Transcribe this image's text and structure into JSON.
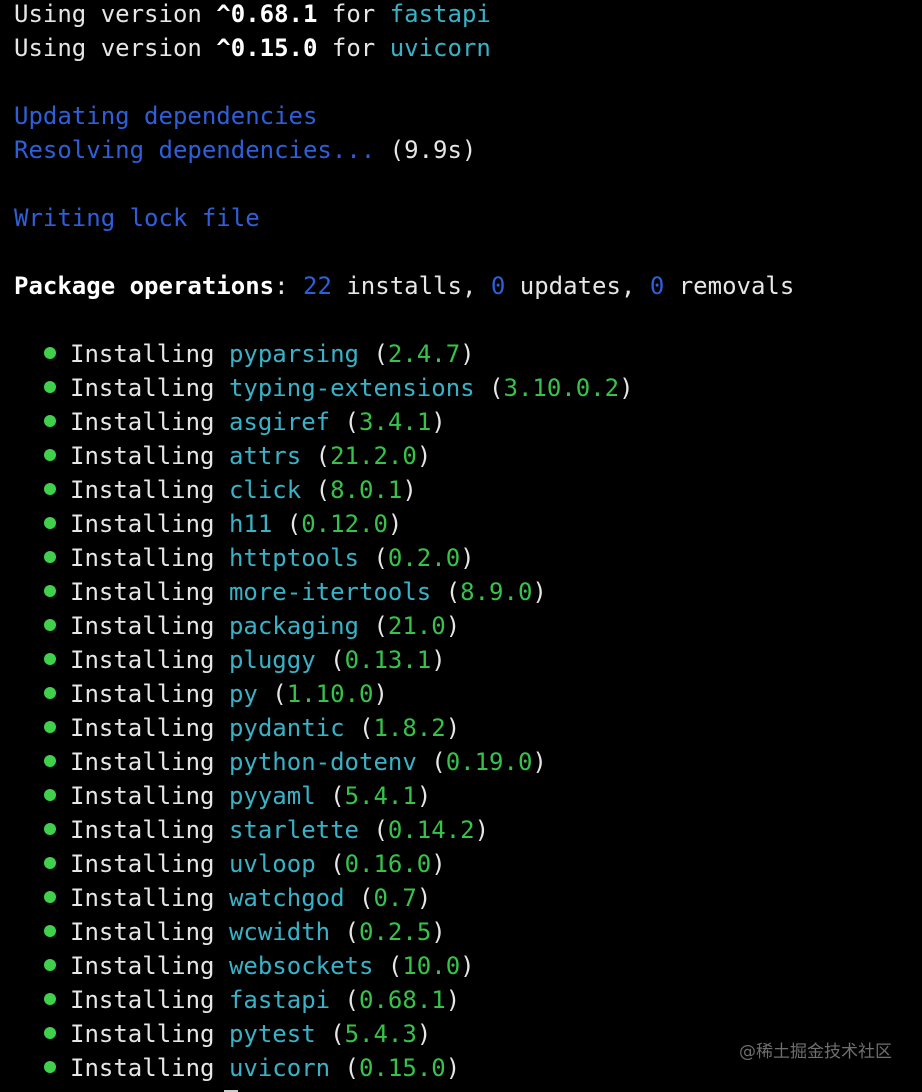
{
  "header_lines": [
    {
      "prefix": "Using version ",
      "version": "^0.68.1",
      "mid": " for ",
      "package": "fastapi"
    },
    {
      "prefix": "Using version ",
      "version": "^0.15.0",
      "mid": " for ",
      "package": "uvicorn"
    }
  ],
  "status": {
    "updating": "Updating dependencies",
    "resolving": "Resolving dependencies...",
    "resolving_time": " (9.9s)",
    "writing": "Writing lock file"
  },
  "operations": {
    "label": "Package operations",
    "sep": ": ",
    "installs_count": "22",
    "installs_label": " installs, ",
    "updates_count": "0",
    "updates_label": " updates, ",
    "removals_count": "0",
    "removals_label": " removals"
  },
  "install_verb": "Installing",
  "packages": [
    {
      "name": "pyparsing",
      "version": "2.4.7"
    },
    {
      "name": "typing-extensions",
      "version": "3.10.0.2"
    },
    {
      "name": "asgiref",
      "version": "3.4.1"
    },
    {
      "name": "attrs",
      "version": "21.2.0"
    },
    {
      "name": "click",
      "version": "8.0.1"
    },
    {
      "name": "h11",
      "version": "0.12.0"
    },
    {
      "name": "httptools",
      "version": "0.2.0"
    },
    {
      "name": "more-itertools",
      "version": "8.9.0"
    },
    {
      "name": "packaging",
      "version": "21.0"
    },
    {
      "name": "pluggy",
      "version": "0.13.1"
    },
    {
      "name": "py",
      "version": "1.10.0"
    },
    {
      "name": "pydantic",
      "version": "1.8.2"
    },
    {
      "name": "python-dotenv",
      "version": "0.19.0"
    },
    {
      "name": "pyyaml",
      "version": "5.4.1"
    },
    {
      "name": "starlette",
      "version": "0.14.2"
    },
    {
      "name": "uvloop",
      "version": "0.16.0"
    },
    {
      "name": "watchgod",
      "version": "0.7"
    },
    {
      "name": "wcwidth",
      "version": "0.2.5"
    },
    {
      "name": "websockets",
      "version": "10.0"
    },
    {
      "name": "fastapi",
      "version": "0.68.1"
    },
    {
      "name": "pytest",
      "version": "5.4.3"
    },
    {
      "name": "uvicorn",
      "version": "0.15.0"
    }
  ],
  "watermark": "@稀土掘金技术社区",
  "colors": {
    "background": "#000000",
    "text": "#e6e6e6",
    "blue": "#2f5fd8",
    "cyan": "#39b2c7",
    "green": "#37c34a",
    "bullet": "#3fd14b"
  }
}
